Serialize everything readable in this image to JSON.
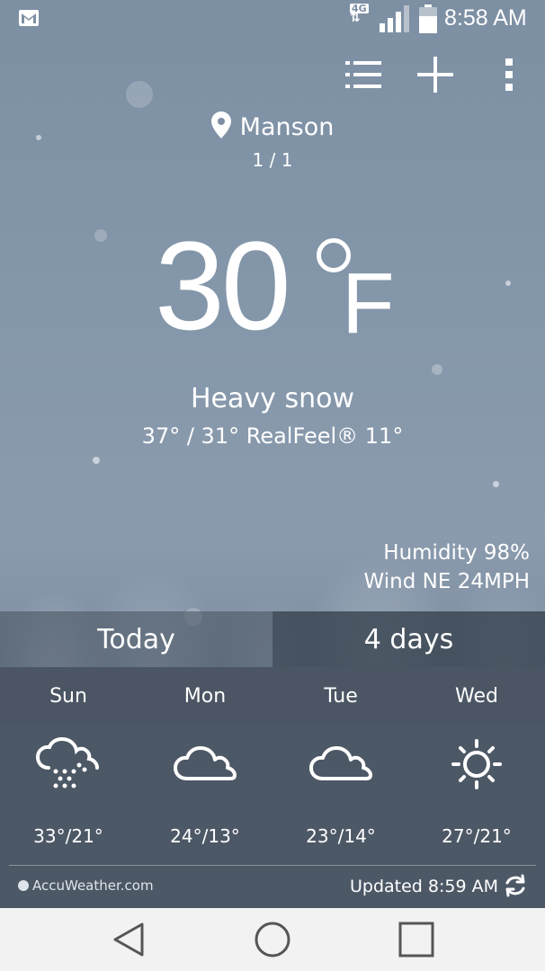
{
  "status_bar": {
    "network": "4G",
    "time": "8:58 AM"
  },
  "toolbar": {
    "icons": [
      "list-icon",
      "add-icon",
      "more-vert-icon"
    ]
  },
  "location": {
    "name": "Manson",
    "page_indicator": "1 / 1"
  },
  "current": {
    "temp": "30",
    "unit": "F",
    "condition": "Heavy snow",
    "hilo_realfeel": "37° / 31° RealFeel® 11°",
    "humidity": "Humidity 98%",
    "wind": "Wind NE 24MPH"
  },
  "tabs": [
    {
      "label": "Today",
      "selected": false
    },
    {
      "label": "4 days",
      "selected": true
    }
  ],
  "forecast": [
    {
      "day": "Sun",
      "icon": "snow-cloud-icon",
      "temps": "33°/21°"
    },
    {
      "day": "Mon",
      "icon": "cloud-icon",
      "temps": "24°/13°"
    },
    {
      "day": "Tue",
      "icon": "cloud-icon",
      "temps": "23°/14°"
    },
    {
      "day": "Wed",
      "icon": "sun-icon",
      "temps": "27°/21°"
    }
  ],
  "footer": {
    "brand": "AccuWeather.com",
    "updated": "Updated 8:59 AM"
  },
  "colors": {
    "sky": "#7d8fa3",
    "forecast_panel": "#4d5866",
    "nav_bar": "#f2f2f2"
  }
}
